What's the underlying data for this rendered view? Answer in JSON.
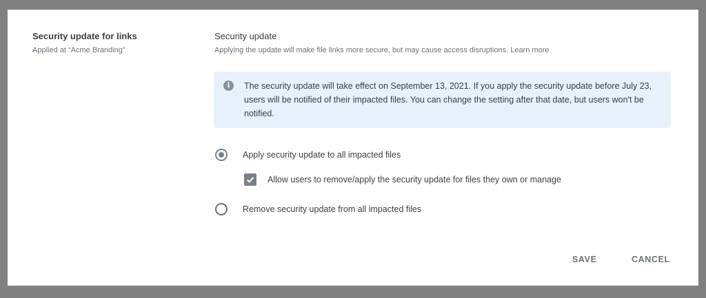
{
  "left": {
    "title": "Security update for links",
    "subtitle": "Applied at “Acme Branding”"
  },
  "section": {
    "title": "Security update",
    "description": "Applying the update will make file links more secure, but may cause access disruptions.",
    "learn_more": "Learn more"
  },
  "info": {
    "icon": "info-icon",
    "text": "The security update will take effect on September 13, 2021. If you apply the security update before July 23, users will be notified of their impacted files. You can change the setting after that date, but users won't be notified."
  },
  "options": {
    "apply_all": {
      "label": "Apply security update to all impacted files",
      "selected": true
    },
    "allow_users": {
      "label": "Allow users to remove/apply the security update for files they own or manage",
      "checked": true
    },
    "remove_all": {
      "label": "Remove security update from all impacted files",
      "selected": false
    }
  },
  "buttons": {
    "save": "SAVE",
    "cancel": "CANCEL"
  }
}
